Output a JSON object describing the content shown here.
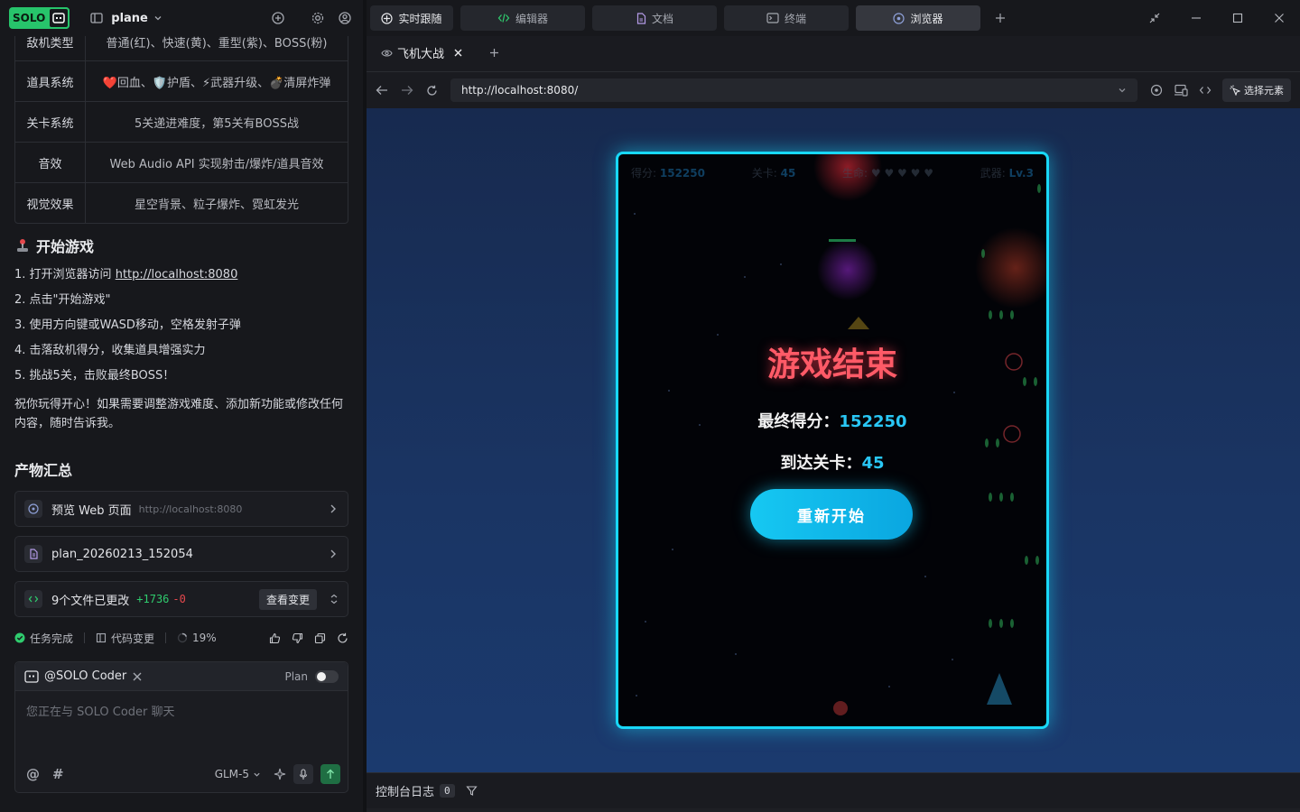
{
  "app": {
    "logo_text": "SOLO",
    "project": "plane"
  },
  "features_table": [
    {
      "key": "敌机类型",
      "value": "普通(红)、快速(黄)、重型(紫)、BOSS(粉)"
    },
    {
      "key": "道具系统",
      "value": "❤️回血、🛡️护盾、⚡武器升级、💣清屏炸弹"
    },
    {
      "key": "关卡系统",
      "value": "5关递进难度，第5关有BOSS战"
    },
    {
      "key": "音效",
      "value": "Web Audio API 实现射击/爆炸/道具音效"
    },
    {
      "key": "视觉效果",
      "value": "星空背景、粒子爆炸、霓虹发光"
    }
  ],
  "start_heading": "开始游戏",
  "steps": [
    {
      "num": "1.",
      "text": "打开浏览器访问",
      "link": "http://localhost:8080"
    },
    {
      "num": "2.",
      "text": "点击\"开始游戏\"",
      "link": ""
    },
    {
      "num": "3.",
      "text": "使用方向键或WASD移动，空格发射子弹",
      "link": ""
    },
    {
      "num": "4.",
      "text": "击落敌机得分，收集道具增强实力",
      "link": ""
    },
    {
      "num": "5.",
      "text": "挑战5关，击败最终BOSS！",
      "link": ""
    }
  ],
  "closing_text": "祝你玩得开心！如果需要调整游戏难度、添加新功能或修改任何内容，随时告诉我。",
  "artifacts_heading": "产物汇总",
  "artifacts": {
    "preview": {
      "label": "预览 Web 页面",
      "sub": "http://localhost:8080"
    },
    "plan": {
      "label": "plan_20260213_152054"
    },
    "changes": {
      "label": "9个文件已更改",
      "plus": "+1736",
      "minus": "-0",
      "button": "查看变更"
    }
  },
  "status": {
    "done": "任务完成",
    "code_changes": "代码变更",
    "progress": "19%"
  },
  "chat": {
    "agent": "@SOLO Coder",
    "plan_label": "Plan",
    "placeholder": "您正在与 SOLO Coder 聊天",
    "at": "@",
    "hash": "#",
    "model": "GLM-5"
  },
  "top_tabs": [
    {
      "label": "实时跟随",
      "active": false
    },
    {
      "label": "编辑器",
      "active": false
    },
    {
      "label": "文档",
      "active": false
    },
    {
      "label": "终端",
      "active": false
    },
    {
      "label": "浏览器",
      "active": true
    }
  ],
  "browser": {
    "tab_title": "飞机大战",
    "url": "http://localhost:8080/",
    "pick_label": "选择元素"
  },
  "game": {
    "hud": {
      "score_label": "得分:",
      "score": "152250",
      "level_label": "关卡:",
      "level": "45",
      "life_label": "生命:",
      "weapon_label": "武器:",
      "weapon": "Lv.3"
    },
    "title": "游戏结束",
    "final_score_label": "最终得分：",
    "final_score": "152250",
    "level_reached_label": "到达关卡：",
    "level_reached": "45",
    "restart": "重新开始"
  },
  "console": {
    "label": "控制台日志",
    "count": "0"
  },
  "colors": {
    "accent_green": "#27c46b",
    "neon_cyan": "#18d8f8",
    "game_over_red": "#ff5a67"
  }
}
